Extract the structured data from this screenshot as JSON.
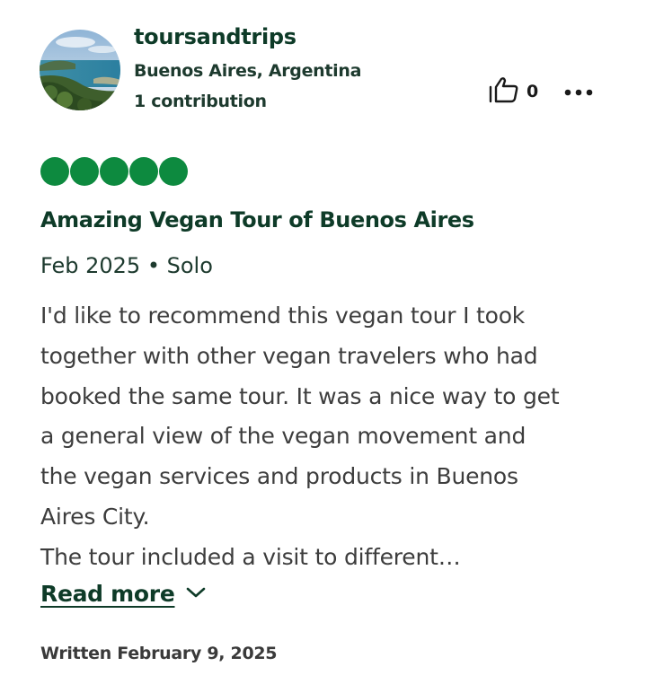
{
  "reviewer": {
    "username": "toursandtrips",
    "location": "Buenos Aires, Argentina",
    "contributions": "1 contribution"
  },
  "helpful": {
    "count": "0",
    "icon": "thumbs-up-icon"
  },
  "more_menu": {
    "icon": "more-options-icon"
  },
  "rating": {
    "value": 5,
    "max": 5,
    "color": "#0d8a3f"
  },
  "review": {
    "title": "Amazing Vegan Tour of Buenos Aires",
    "meta": "Feb 2025 • Solo",
    "body_lines": [
      "I'd like to recommend this vegan tour I took",
      "together with other vegan travelers who had",
      "booked the same tour. It was a nice way to get",
      "a general view of the vegan movement and",
      "the vegan services and products in Buenos",
      "Aires City.",
      "The tour included a visit to different…"
    ],
    "read_more_label": "Read more",
    "written_date": "Written February 9, 2025"
  },
  "colors": {
    "brand_green": "#0d8a3f",
    "title_green": "#0e3b28",
    "body_gray": "#3d3d3d"
  }
}
